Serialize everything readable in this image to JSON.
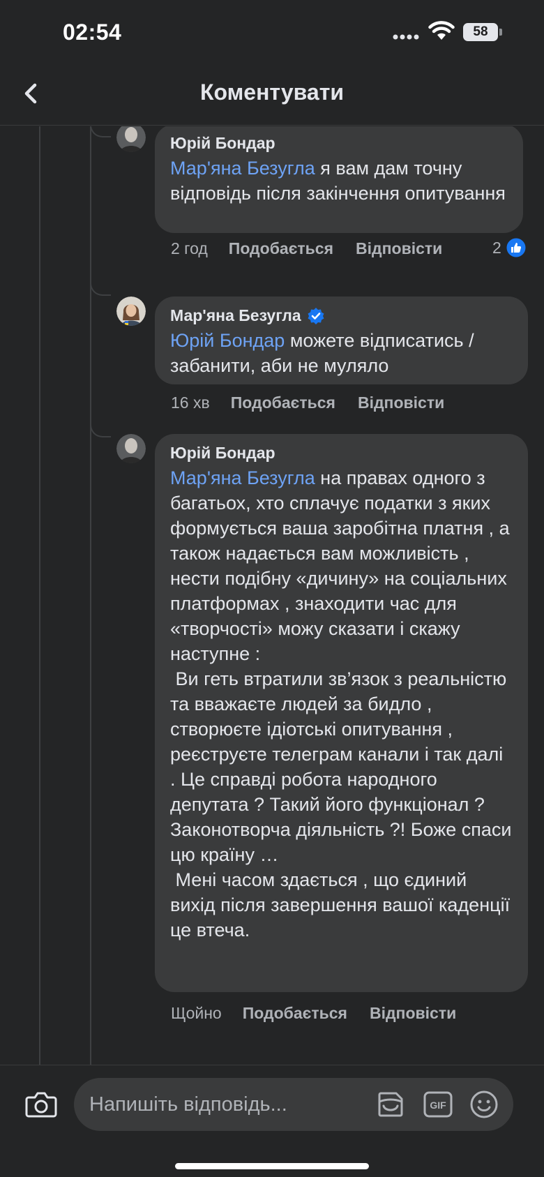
{
  "status_bar": {
    "time": "02:54",
    "battery": "58"
  },
  "header": {
    "title": "Коментувати"
  },
  "comments": [
    {
      "author": "Юрій Бондар",
      "mention": "Мар'яна Безугла",
      "text": " я вам дам точну відповідь після закінчення опитування",
      "time": "2 год",
      "like_label": "Подобається",
      "reply_label": "Відповісти",
      "reactions_count": "2"
    },
    {
      "author": "Мар'яна Безугла",
      "verified": true,
      "mention": "Юрій Бондар",
      "text": " можете відписатись / забанити, аби не муляло",
      "time": "16 хв",
      "like_label": "Подобається",
      "reply_label": "Відповісти"
    },
    {
      "author": "Юрій Бондар",
      "mention": "Мар'яна Безугла",
      "text": " на правах одного з багатьох, хто сплачує податки з яких формується ваша заробітна платня , а також надається вам можливість , нести подібну «дичину» на соціальних платформах , знаходити час для «творчості» можу сказати і скажу наступне :\n Ви геть втратили зв’язок з реальністю та вважаєте людей за бидло , створюєте ідіотські опитування , реєструєте телеграм канали і так далі . Це справді робота народного депутата ? Такий його функціонал ? Законотворча діяльність ?! Боже спаси цю країну …\n Мені часом здається , що єдиний вихід після завершення вашої каденції це втеча.",
      "time": "Щойно",
      "like_label": "Подобається",
      "reply_label": "Відповісти"
    }
  ],
  "composer": {
    "placeholder": "Напишіть відповідь..."
  },
  "colors": {
    "background": "#242526",
    "bubble": "#3a3b3c",
    "mention": "#6ea3f5",
    "secondary_text": "#b0b3b8",
    "like_blue": "#1877f2"
  },
  "icons": [
    "back-icon",
    "signal-icon",
    "wifi-icon",
    "verified-icon",
    "like-icon",
    "camera-icon",
    "sticker-icon",
    "gif-icon",
    "emoji-icon"
  ]
}
